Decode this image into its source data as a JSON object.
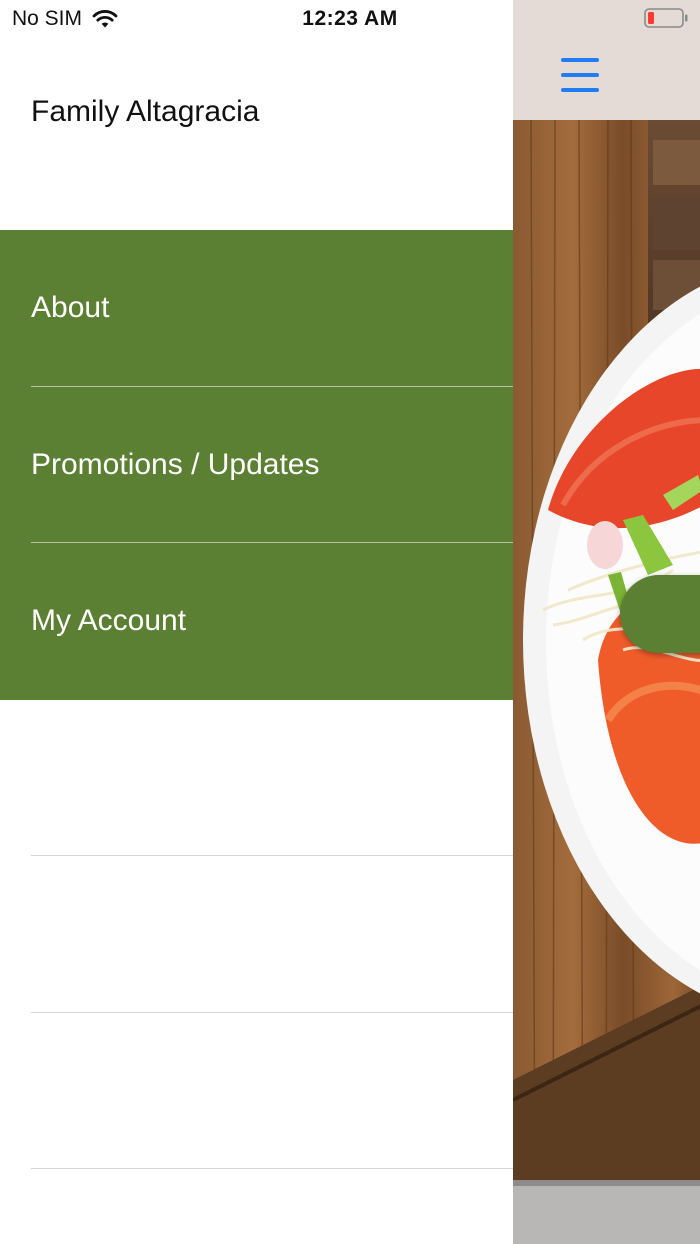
{
  "status_bar": {
    "carrier": "No SIM",
    "time": "12:23 AM",
    "battery_color": "#ff3b30"
  },
  "drawer": {
    "title": "Family Altagracia",
    "menu_items": [
      {
        "label": "About",
        "active": true
      },
      {
        "label": "Promotions / Updates",
        "active": true
      },
      {
        "label": "My Account",
        "active": true
      },
      {
        "label": "",
        "active": false
      },
      {
        "label": "",
        "active": false
      },
      {
        "label": "",
        "active": false
      }
    ]
  },
  "main": {
    "menu_icon": "hamburger-icon",
    "accent_color": "#1f7cf2",
    "brand_green": "#5b8033"
  }
}
